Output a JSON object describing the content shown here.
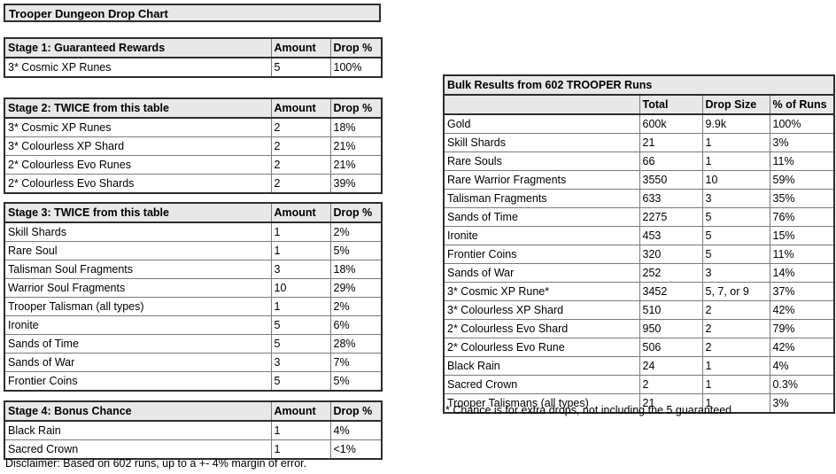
{
  "title": "Trooper Dungeon Drop Chart",
  "left_tables": [
    {
      "id": "stage1",
      "header": {
        "name": "Stage 1: Guaranteed Rewards",
        "amount": "Amount",
        "drop": "Drop %"
      },
      "rows": [
        {
          "name": "3* Cosmic XP Runes",
          "amount": "5",
          "drop": "100%"
        }
      ]
    },
    {
      "id": "stage2",
      "header": {
        "name": "Stage 2: TWICE from this table",
        "amount": "Amount",
        "drop": "Drop %"
      },
      "rows": [
        {
          "name": "3* Cosmic XP Runes",
          "amount": "2",
          "drop": "18%"
        },
        {
          "name": "3* Colourless XP Shard",
          "amount": "2",
          "drop": "21%"
        },
        {
          "name": "2* Colourless Evo Runes",
          "amount": "2",
          "drop": "21%"
        },
        {
          "name": "2* Colourless Evo Shards",
          "amount": "2",
          "drop": "39%"
        }
      ]
    },
    {
      "id": "stage3",
      "header": {
        "name": "Stage 3: TWICE from this table",
        "amount": "Amount",
        "drop": "Drop %"
      },
      "rows": [
        {
          "name": "Skill Shards",
          "amount": "1",
          "drop": "2%"
        },
        {
          "name": "Rare Soul",
          "amount": "1",
          "drop": "5%"
        },
        {
          "name": "Talisman Soul Fragments",
          "amount": "3",
          "drop": "18%"
        },
        {
          "name": "Warrior Soul Fragments",
          "amount": "10",
          "drop": "29%"
        },
        {
          "name": "Trooper Talisman (all types)",
          "amount": "1",
          "drop": "2%"
        },
        {
          "name": "Ironite",
          "amount": "5",
          "drop": "6%"
        },
        {
          "name": "Sands of Time",
          "amount": "5",
          "drop": "28%"
        },
        {
          "name": "Sands of War",
          "amount": "3",
          "drop": "7%"
        },
        {
          "name": "Frontier Coins",
          "amount": "5",
          "drop": "5%"
        }
      ]
    },
    {
      "id": "stage4",
      "header": {
        "name": "Stage 4: Bonus Chance",
        "amount": "Amount",
        "drop": "Drop %"
      },
      "rows": [
        {
          "name": "Black Rain",
          "amount": "1",
          "drop": "4%"
        },
        {
          "name": "Sacred Crown",
          "amount": "1",
          "drop": "<1%"
        }
      ]
    }
  ],
  "disclaimer": "Disclaimer: Based on 602 runs, up to a +- 4% margin of error.",
  "bulk": {
    "caption": "Bulk Results from 602 TROOPER Runs",
    "columns": {
      "name": "",
      "total": "Total",
      "drop_size": "Drop Size",
      "pct": "% of Runs"
    },
    "rows": [
      {
        "name": "Gold",
        "total": "600k",
        "drop_size": "9.9k",
        "pct": "100%"
      },
      {
        "name": "Skill Shards",
        "total": "21",
        "drop_size": "1",
        "pct": "3%"
      },
      {
        "name": "Rare Souls",
        "total": "66",
        "drop_size": "1",
        "pct": "11%"
      },
      {
        "name": "Rare Warrior Fragments",
        "total": "3550",
        "drop_size": "10",
        "pct": "59%"
      },
      {
        "name": "Talisman Fragments",
        "total": "633",
        "drop_size": "3",
        "pct": "35%"
      },
      {
        "name": "Sands of Time",
        "total": "2275",
        "drop_size": "5",
        "pct": "76%"
      },
      {
        "name": "Ironite",
        "total": "453",
        "drop_size": "5",
        "pct": "15%"
      },
      {
        "name": "Frontier Coins",
        "total": "320",
        "drop_size": "5",
        "pct": "11%"
      },
      {
        "name": "Sands of War",
        "total": "252",
        "drop_size": "3",
        "pct": "14%"
      },
      {
        "name": "3* Cosmic XP Rune*",
        "total": "3452",
        "drop_size": "5, 7, or 9",
        "pct": "37%"
      },
      {
        "name": "3* Colourless XP Shard",
        "total": "510",
        "drop_size": "2",
        "pct": "42%"
      },
      {
        "name": "2* Colourless Evo Shard",
        "total": "950",
        "drop_size": "2",
        "pct": "79%"
      },
      {
        "name": "2* Colourless Evo Rune",
        "total": "506",
        "drop_size": "2",
        "pct": "42%"
      },
      {
        "name": "Black Rain",
        "total": "24",
        "drop_size": "1",
        "pct": "4%"
      },
      {
        "name": "Sacred Crown",
        "total": "2",
        "drop_size": "1",
        "pct": "0.3%"
      },
      {
        "name": "Trooper Talismans (all types)",
        "total": "21",
        "drop_size": "1",
        "pct": "3%"
      }
    ]
  },
  "footnote": "* Chance is for extra drops, not including the 5 guaranteed.",
  "colors": {
    "header_fill": "#e8e8e8",
    "border_outer": "#2d2d2d",
    "border_inner": "#7a7a7a",
    "page_background": "#ffffff"
  }
}
